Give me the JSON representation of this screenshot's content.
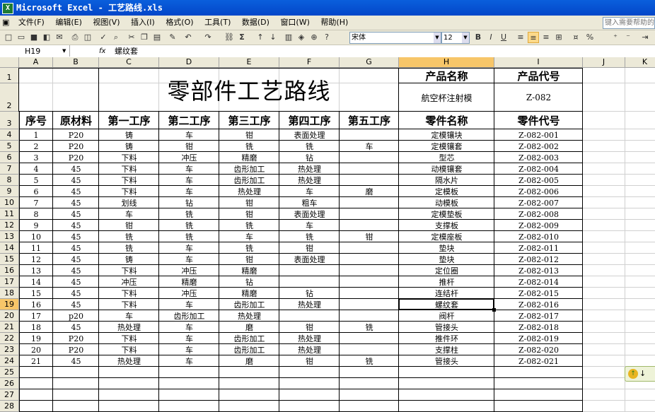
{
  "window": {
    "title": "Microsoft Excel - 工艺路线.xls"
  },
  "menu": {
    "items": [
      "文件(F)",
      "编辑(E)",
      "视图(V)",
      "插入(I)",
      "格式(O)",
      "工具(T)",
      "数据(D)",
      "窗口(W)",
      "帮助(H)"
    ],
    "help_placeholder": "键入需要帮助的"
  },
  "toolbar": {
    "font_name": "宋体",
    "font_size": "12",
    "bold": "B",
    "italic": "I",
    "underline": "U",
    "percent": "%"
  },
  "formula_bar": {
    "cell_ref": "H19",
    "fx": "fx",
    "content": "螺纹套"
  },
  "columns": [
    "A",
    "B",
    "C",
    "D",
    "E",
    "F",
    "G",
    "H",
    "I",
    "J",
    "K"
  ],
  "selected": {
    "column": "H",
    "row": "19"
  },
  "sheet": {
    "title": "零部件工艺路线",
    "product_name_label": "产品名称",
    "product_code_label": "产品代号",
    "product_name": "航空杯注射模",
    "product_code": "Z-082",
    "headers": [
      "序号",
      "原材料",
      "第一工序",
      "第二工序",
      "第三工序",
      "第四工序",
      "第五工序",
      "零件名称",
      "零件代号"
    ],
    "rows": [
      [
        "1",
        "P20",
        "铸",
        "车",
        "钳",
        "表面处理",
        "",
        "定模镶块",
        "Z-082-001"
      ],
      [
        "2",
        "P20",
        "铸",
        "钳",
        "铣",
        "铣",
        "车",
        "定模镶套",
        "Z-082-002"
      ],
      [
        "3",
        "P20",
        "下料",
        "冲压",
        "精磨",
        "钻",
        "",
        "型芯",
        "Z-082-003"
      ],
      [
        "4",
        "45",
        "下料",
        "车",
        "齿形加工",
        "热处理",
        "",
        "动模镶套",
        "Z-082-004"
      ],
      [
        "5",
        "45",
        "下料",
        "车",
        "齿形加工",
        "热处理",
        "",
        "隔水片",
        "Z-082-005"
      ],
      [
        "6",
        "45",
        "下料",
        "车",
        "热处理",
        "车",
        "磨",
        "定模板",
        "Z-082-006"
      ],
      [
        "7",
        "45",
        "划线",
        "钻",
        "钳",
        "粗车",
        "",
        "动模板",
        "Z-082-007"
      ],
      [
        "8",
        "45",
        "车",
        "铣",
        "钳",
        "表面处理",
        "",
        "定模垫板",
        "Z-082-008"
      ],
      [
        "9",
        "45",
        "钳",
        "铣",
        "铣",
        "车",
        "",
        "支撑板",
        "Z-082-009"
      ],
      [
        "10",
        "45",
        "铣",
        "铣",
        "车",
        "铣",
        "钳",
        "定模座板",
        "Z-082-010"
      ],
      [
        "11",
        "45",
        "铣",
        "车",
        "铣",
        "钳",
        "",
        "垫块",
        "Z-082-011"
      ],
      [
        "12",
        "45",
        "铸",
        "车",
        "钳",
        "表面处理",
        "",
        "垫块",
        "Z-082-012"
      ],
      [
        "13",
        "45",
        "下料",
        "冲压",
        "精磨",
        "",
        "",
        "定位圈",
        "Z-082-013"
      ],
      [
        "14",
        "45",
        "冲压",
        "精磨",
        "钻",
        "",
        "",
        "推杆",
        "Z-082-014"
      ],
      [
        "15",
        "45",
        "下料",
        "冲压",
        "精磨",
        "钻",
        "",
        "连结杆",
        "Z-082-015"
      ],
      [
        "16",
        "45",
        "下料",
        "车",
        "齿形加工",
        "热处理",
        "",
        "螺纹套",
        "Z-082-016"
      ],
      [
        "17",
        "p20",
        "车",
        "齿形加工",
        "热处理",
        "",
        "",
        "阀杆",
        "Z-082-017"
      ],
      [
        "18",
        "45",
        "热处理",
        "车",
        "磨",
        "钳",
        "铣",
        "管接头",
        "Z-082-018"
      ],
      [
        "19",
        "P20",
        "下料",
        "车",
        "齿形加工",
        "热处理",
        "",
        "推件环",
        "Z-082-019"
      ],
      [
        "20",
        "P20",
        "下料",
        "车",
        "齿形加工",
        "热处理",
        "",
        "支撑柱",
        "Z-082-020"
      ],
      [
        "21",
        "45",
        "热处理",
        "车",
        "磨",
        "钳",
        "铣",
        "管接头",
        "Z-082-021"
      ]
    ]
  }
}
